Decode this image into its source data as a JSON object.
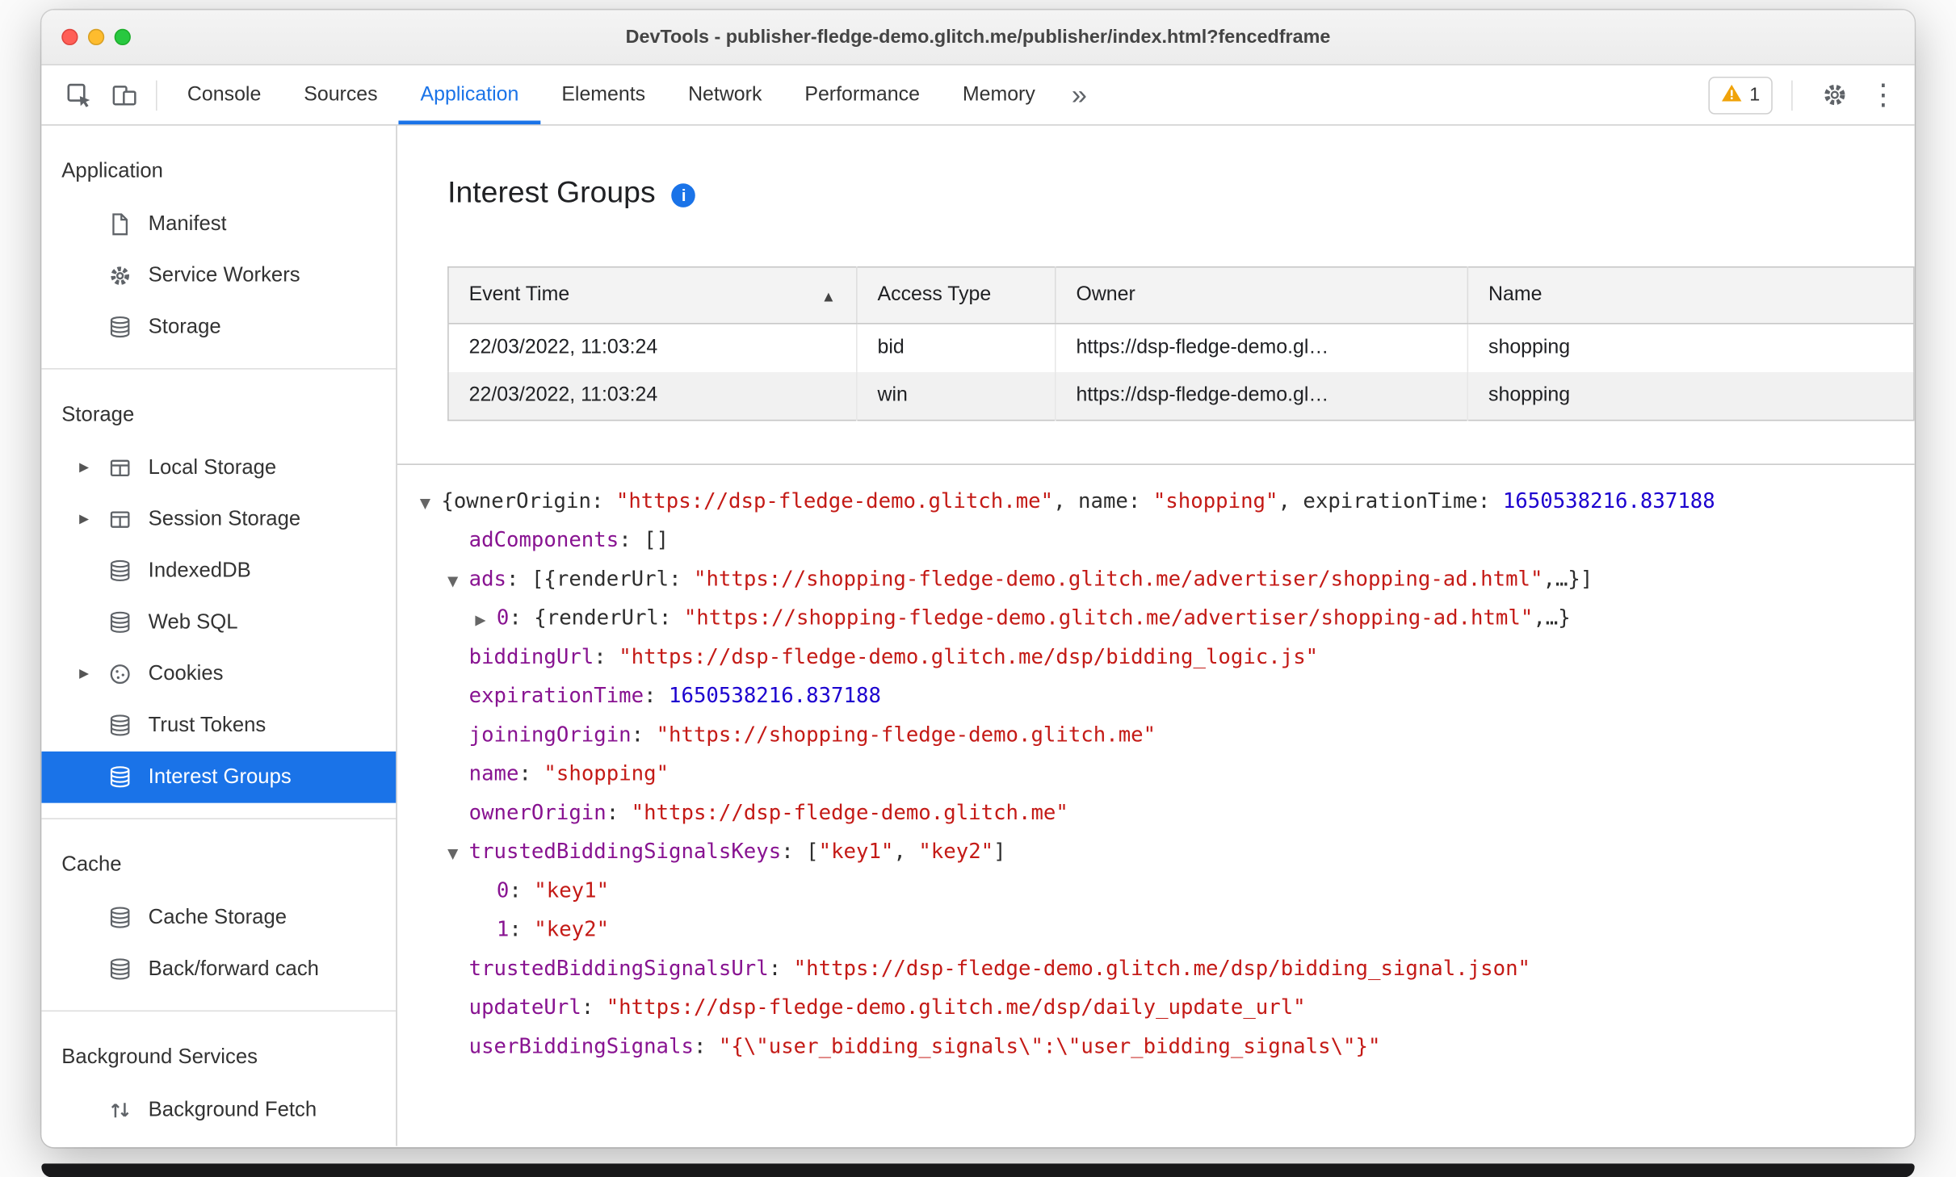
{
  "window": {
    "title": "DevTools - publisher-fledge-demo.glitch.me/publisher/index.html?fencedframe"
  },
  "icons": {
    "info": "i",
    "kebab": "⋮",
    "collapsed": "▶",
    "expanded": "▼"
  },
  "colors": {
    "accent": "#1a73e8",
    "selected_bg": "#1a73e8",
    "key": "#881391",
    "string": "#c41a16",
    "number": "#1c00cf",
    "warning": "#f0a30a"
  },
  "toolbar": {
    "tabs": [
      "Console",
      "Sources",
      "Application",
      "Elements",
      "Network",
      "Performance",
      "Memory"
    ],
    "active_tab": "Application",
    "more_tabs": "»",
    "issues_count": "1"
  },
  "sidebar": {
    "sections": [
      {
        "title": "Application",
        "items": [
          {
            "label": "Manifest",
            "icon": "document",
            "expandable": false,
            "selected": false
          },
          {
            "label": "Service Workers",
            "icon": "gear",
            "expandable": false,
            "selected": false
          },
          {
            "label": "Storage",
            "icon": "database",
            "expandable": false,
            "selected": false
          }
        ]
      },
      {
        "title": "Storage",
        "items": [
          {
            "label": "Local Storage",
            "icon": "table",
            "expandable": true,
            "selected": false
          },
          {
            "label": "Session Storage",
            "icon": "table",
            "expandable": true,
            "selected": false
          },
          {
            "label": "IndexedDB",
            "icon": "database",
            "expandable": false,
            "selected": false
          },
          {
            "label": "Web SQL",
            "icon": "database",
            "expandable": false,
            "selected": false
          },
          {
            "label": "Cookies",
            "icon": "cookie",
            "expandable": true,
            "selected": false
          },
          {
            "label": "Trust Tokens",
            "icon": "database",
            "expandable": false,
            "selected": false
          },
          {
            "label": "Interest Groups",
            "icon": "database",
            "expandable": false,
            "selected": true
          }
        ]
      },
      {
        "title": "Cache",
        "items": [
          {
            "label": "Cache Storage",
            "icon": "database",
            "expandable": false,
            "selected": false
          },
          {
            "label": "Back/forward cach",
            "icon": "database",
            "expandable": false,
            "selected": false
          }
        ]
      },
      {
        "title": "Background Services",
        "items": [
          {
            "label": "Background Fetch",
            "icon": "fetch",
            "expandable": false,
            "selected": false
          }
        ]
      }
    ]
  },
  "main": {
    "title": "Interest Groups",
    "table": {
      "columns": [
        {
          "label": "Event Time",
          "sort": "▲"
        },
        {
          "label": "Access Type"
        },
        {
          "label": "Owner"
        },
        {
          "label": "Name"
        }
      ],
      "rows": [
        [
          "22/03/2022, 11:03:24",
          "bid",
          "https://dsp-fledge-demo.gl…",
          "shopping"
        ],
        [
          "22/03/2022, 11:03:24",
          "win",
          "https://dsp-fledge-demo.gl…",
          "shopping"
        ]
      ]
    },
    "tree": {
      "lines": [
        {
          "ind": 0,
          "arrow": "▼",
          "seg": [
            [
              "sp",
              "{"
            ],
            [
              "sp",
              "ownerOrigin"
            ],
            [
              "sp",
              ": "
            ],
            [
              "ss",
              "\"https://dsp-fledge-demo.glitch.me\""
            ],
            [
              "sp",
              ", "
            ],
            [
              "sp",
              "name"
            ],
            [
              "sp",
              ": "
            ],
            [
              "ss",
              "\"shopping\""
            ],
            [
              "sp",
              ", "
            ],
            [
              "sp",
              "expirationTime"
            ],
            [
              "sp",
              ": "
            ],
            [
              "sn",
              "1650538216.837188"
            ]
          ]
        },
        {
          "ind": 1,
          "arrow": "",
          "seg": [
            [
              "sk",
              "adComponents"
            ],
            [
              "sp",
              ": []"
            ]
          ]
        },
        {
          "ind": 1,
          "arrow": "▼",
          "seg": [
            [
              "sk",
              "ads"
            ],
            [
              "sp",
              ": [{"
            ],
            [
              "sp",
              "renderUrl"
            ],
            [
              "sp",
              ": "
            ],
            [
              "ss",
              "\"https://shopping-fledge-demo.glitch.me/advertiser/shopping-ad.html\""
            ],
            [
              "sp",
              ",…}]"
            ]
          ]
        },
        {
          "ind": 2,
          "arrow": "▶",
          "seg": [
            [
              "sk",
              "0"
            ],
            [
              "sp",
              ": {"
            ],
            [
              "sp",
              "renderUrl"
            ],
            [
              "sp",
              ": "
            ],
            [
              "ss",
              "\"https://shopping-fledge-demo.glitch.me/advertiser/shopping-ad.html\""
            ],
            [
              "sp",
              ",…}"
            ]
          ]
        },
        {
          "ind": 1,
          "arrow": "",
          "seg": [
            [
              "sk",
              "biddingUrl"
            ],
            [
              "sp",
              ": "
            ],
            [
              "ss",
              "\"https://dsp-fledge-demo.glitch.me/dsp/bidding_logic.js\""
            ]
          ]
        },
        {
          "ind": 1,
          "arrow": "",
          "seg": [
            [
              "sk",
              "expirationTime"
            ],
            [
              "sp",
              ": "
            ],
            [
              "sn",
              "1650538216.837188"
            ]
          ]
        },
        {
          "ind": 1,
          "arrow": "",
          "seg": [
            [
              "sk",
              "joiningOrigin"
            ],
            [
              "sp",
              ": "
            ],
            [
              "ss",
              "\"https://shopping-fledge-demo.glitch.me\""
            ]
          ]
        },
        {
          "ind": 1,
          "arrow": "",
          "seg": [
            [
              "sk",
              "name"
            ],
            [
              "sp",
              ": "
            ],
            [
              "ss",
              "\"shopping\""
            ]
          ]
        },
        {
          "ind": 1,
          "arrow": "",
          "seg": [
            [
              "sk",
              "ownerOrigin"
            ],
            [
              "sp",
              ": "
            ],
            [
              "ss",
              "\"https://dsp-fledge-demo.glitch.me\""
            ]
          ]
        },
        {
          "ind": 1,
          "arrow": "▼",
          "seg": [
            [
              "sk",
              "trustedBiddingSignalsKeys"
            ],
            [
              "sp",
              ": ["
            ],
            [
              "ss",
              "\"key1\""
            ],
            [
              "sp",
              ", "
            ],
            [
              "ss",
              "\"key2\""
            ],
            [
              "sp",
              "]"
            ]
          ]
        },
        {
          "ind": 2,
          "arrow": "",
          "seg": [
            [
              "sk",
              "0"
            ],
            [
              "sp",
              ": "
            ],
            [
              "ss",
              "\"key1\""
            ]
          ]
        },
        {
          "ind": 2,
          "arrow": "",
          "seg": [
            [
              "sk",
              "1"
            ],
            [
              "sp",
              ": "
            ],
            [
              "ss",
              "\"key2\""
            ]
          ]
        },
        {
          "ind": 1,
          "arrow": "",
          "seg": [
            [
              "sk",
              "trustedBiddingSignalsUrl"
            ],
            [
              "sp",
              ": "
            ],
            [
              "ss",
              "\"https://dsp-fledge-demo.glitch.me/dsp/bidding_signal.json\""
            ]
          ]
        },
        {
          "ind": 1,
          "arrow": "",
          "seg": [
            [
              "sk",
              "updateUrl"
            ],
            [
              "sp",
              ": "
            ],
            [
              "ss",
              "\"https://dsp-fledge-demo.glitch.me/dsp/daily_update_url\""
            ]
          ]
        },
        {
          "ind": 1,
          "arrow": "",
          "seg": [
            [
              "sk",
              "userBiddingSignals"
            ],
            [
              "sp",
              ": "
            ],
            [
              "ss",
              "\"{\\\"user_bidding_signals\\\":\\\"user_bidding_signals\\\"}\""
            ]
          ]
        }
      ]
    }
  }
}
